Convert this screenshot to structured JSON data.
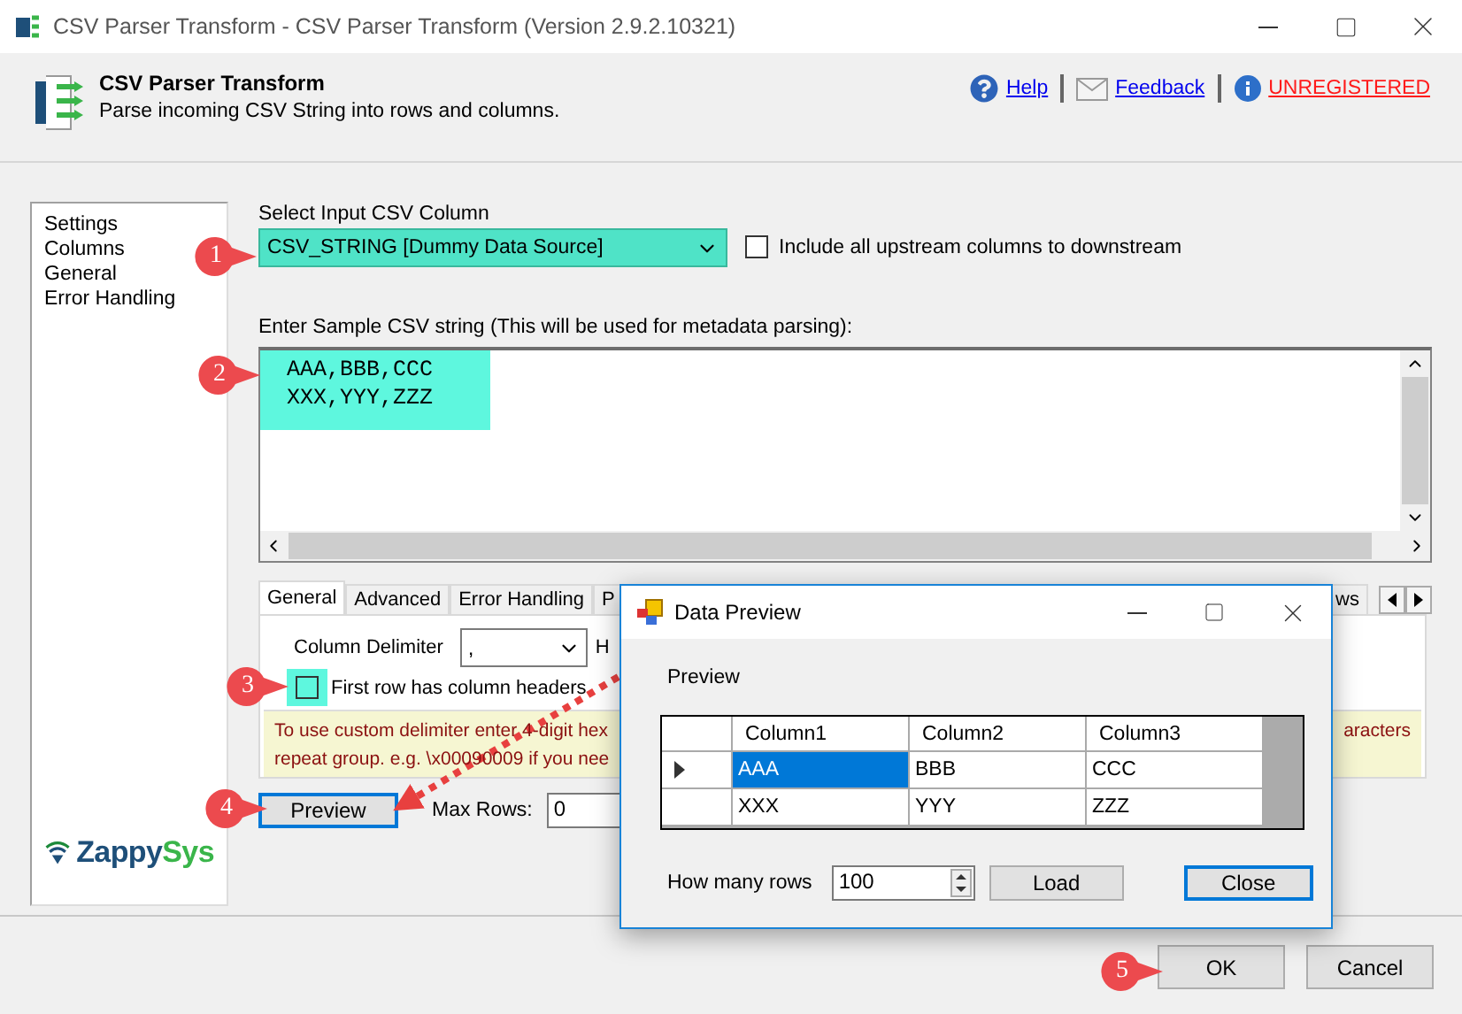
{
  "window": {
    "title": "CSV Parser Transform - CSV Parser Transform (Version 2.9.2.10321)"
  },
  "header": {
    "title": "CSV Parser Transform",
    "subtitle": "Parse incoming CSV String into rows and columns.",
    "links": [
      {
        "label": "Help",
        "kind": "help"
      },
      {
        "label": "Feedback",
        "kind": "feedback"
      },
      {
        "label": "UNREGISTERED",
        "kind": "warning"
      }
    ]
  },
  "nav": {
    "items": [
      "Settings",
      "Columns",
      "General",
      "Error Handling"
    ]
  },
  "logo": {
    "first": "Zappy",
    "second": "Sys"
  },
  "input_column": {
    "label": "Select Input CSV Column",
    "value": "CSV_STRING [Dummy Data Source]"
  },
  "include_upstream": {
    "label": "Include all upstream columns to downstream",
    "checked": false
  },
  "sample": {
    "label": "Enter Sample CSV string (This will be used for metadata parsing):",
    "lines": [
      "AAA,BBB,CCC",
      "XXX,YYY,ZZZ"
    ]
  },
  "tabs": [
    {
      "label": "General",
      "selected": true
    },
    {
      "label": "Advanced",
      "selected": false
    },
    {
      "label": "Error Handling",
      "selected": false
    },
    {
      "label": "P",
      "selected": false
    }
  ],
  "tabs_right": [
    {
      "label": "ws",
      "selected": false
    }
  ],
  "general": {
    "delimiter_label": "Column Delimiter",
    "delimiter_value": ",",
    "cut_label": "H",
    "header_row": {
      "label": "First row has column headers",
      "checked": false
    },
    "hint_lines": [
      {
        "left": "To use custom delimiter enter 4-digit hex",
        "right": "aracters"
      },
      {
        "left": "repeat group. e.g. \\x00090009 if you nee"
      }
    ]
  },
  "preview_button": {
    "label": "Preview",
    "default": true
  },
  "max_rows": {
    "label": "Max Rows:",
    "value": "0"
  },
  "buttons": [
    {
      "label": "OK"
    },
    {
      "label": "Cancel"
    }
  ],
  "dialog": {
    "title": "Data Preview",
    "label": "Preview",
    "columns": [
      "Column1",
      "Column2",
      "Column3"
    ],
    "rows": [
      {
        "current": true,
        "cells": [
          {
            "text": "AAA",
            "selected": true
          },
          {
            "text": "BBB",
            "selected": false
          },
          {
            "text": "CCC",
            "selected": false
          }
        ]
      },
      {
        "current": false,
        "cells": [
          {
            "text": "XXX",
            "selected": false
          },
          {
            "text": "YYY",
            "selected": false
          },
          {
            "text": "ZZZ",
            "selected": false
          }
        ]
      }
    ],
    "rows_label": "How many rows",
    "rows_value": "100",
    "buttons": [
      {
        "label": "Load",
        "default": false
      },
      {
        "label": "Close",
        "default": true
      }
    ]
  },
  "callouts": [
    "1",
    "2",
    "3",
    "4",
    "5"
  ]
}
